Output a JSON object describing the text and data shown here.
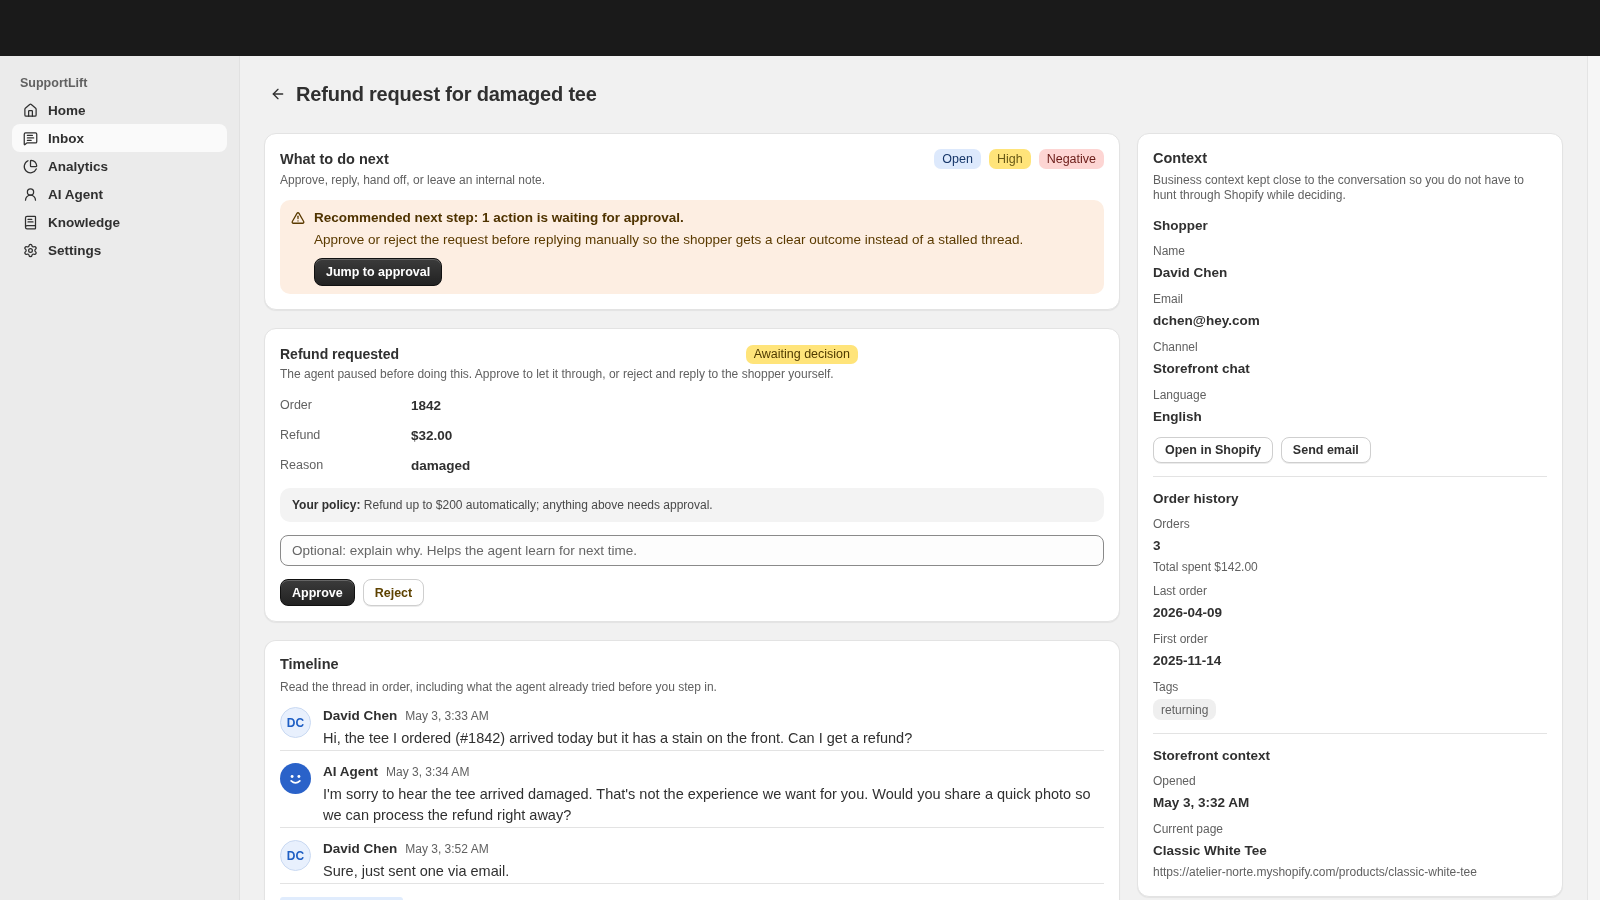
{
  "app": {
    "name": "SupportLift"
  },
  "sidebar": {
    "items": [
      {
        "label": "Home",
        "selected": false
      },
      {
        "label": "Inbox",
        "selected": true
      },
      {
        "label": "Analytics",
        "selected": false
      },
      {
        "label": "AI Agent",
        "selected": false
      },
      {
        "label": "Knowledge",
        "selected": false
      },
      {
        "label": "Settings",
        "selected": false
      }
    ]
  },
  "page": {
    "title": "Refund request for damaged tee"
  },
  "next_step": {
    "title": "What to do next",
    "subtitle": "Approve, reply, hand off, or leave an internal note.",
    "badges": [
      {
        "label": "Open",
        "color": "#dde9fc"
      },
      {
        "label": "High",
        "color": "#ffe47a"
      },
      {
        "label": "Negative",
        "color": "#fdd5d3"
      }
    ],
    "alert": {
      "headline": "Recommended next step: 1 action is waiting for approval.",
      "body": "Approve or reject the request before replying manually so the shopper gets a clear outcome instead of a stalled thread.",
      "button": "Jump to approval"
    }
  },
  "approval": {
    "title": "Refund requested",
    "status": "Awaiting decision",
    "description": "The agent paused before doing this. Approve to let it through, or reject and reply to the shopper yourself.",
    "details": [
      {
        "label": "Order",
        "value": "1842"
      },
      {
        "label": "Refund",
        "value": "$32.00"
      },
      {
        "label": "Reason",
        "value": "damaged"
      }
    ],
    "policy": "**Your policy:** Refund up to $200 automatically; anything above needs approval.",
    "note": {
      "placeholder": "Optional: explain why. Helps the agent learn for next time."
    },
    "buttons": [
      {
        "label": "Approve",
        "kind": "primary"
      },
      {
        "label": "Reject",
        "kind": "secondary"
      }
    ]
  },
  "timeline": {
    "title": "Timeline",
    "subtitle": "Read the thread in order, including what the agent already tried before you step in.",
    "messages": [
      {
        "kind": "shopper",
        "initials": "DC",
        "author": "David Chen",
        "time": "May 3, 3:33 AM",
        "text": "Hi, the tee I ordered (#1842) arrived today but it has a stain on the front. Can I get a refund?"
      },
      {
        "kind": "agent",
        "author": "AI Agent",
        "time": "May 3, 3:34 AM",
        "text": "I'm sorry to hear the tee arrived damaged. That's not the experience we want for you. Would you share a quick photo so we can process the refund right away?"
      },
      {
        "kind": "shopper",
        "initials": "DC",
        "author": "David Chen",
        "time": "May 3, 3:52 AM",
        "text": "Sure, just sent one via email."
      }
    ]
  },
  "context": {
    "title": "Context",
    "subtitle": "Business context kept close to the conversation so you do not have to hunt through Shopify while deciding.",
    "sections": [
      {
        "title": "Shopper",
        "fields": [
          {
            "label": "Name",
            "value": "David Chen"
          },
          {
            "label": "Email",
            "value": "dchen@hey.com"
          },
          {
            "label": "Channel",
            "value": "Storefront chat"
          },
          {
            "label": "Language",
            "value": "English"
          }
        ],
        "buttons": [
          "Open in Shopify",
          "Send email"
        ]
      },
      {
        "title": "Order history",
        "fields": [
          {
            "label": "Orders",
            "value": "3",
            "note": "Total spent $142.00"
          },
          {
            "label": "Last order",
            "value": "2026-04-09"
          },
          {
            "label": "First order",
            "value": "2025-11-14"
          }
        ],
        "tags": {
          "label": "Tags",
          "items": [
            "returning"
          ]
        }
      },
      {
        "title": "Storefront context",
        "fields": [
          {
            "label": "Opened",
            "value": "May 3, 3:32 AM"
          },
          {
            "label": "Current page",
            "value": "Classic White Tee",
            "note": "https://atelier-norte.myshopify.com/products/classic-white-tee"
          }
        ]
      }
    ]
  }
}
